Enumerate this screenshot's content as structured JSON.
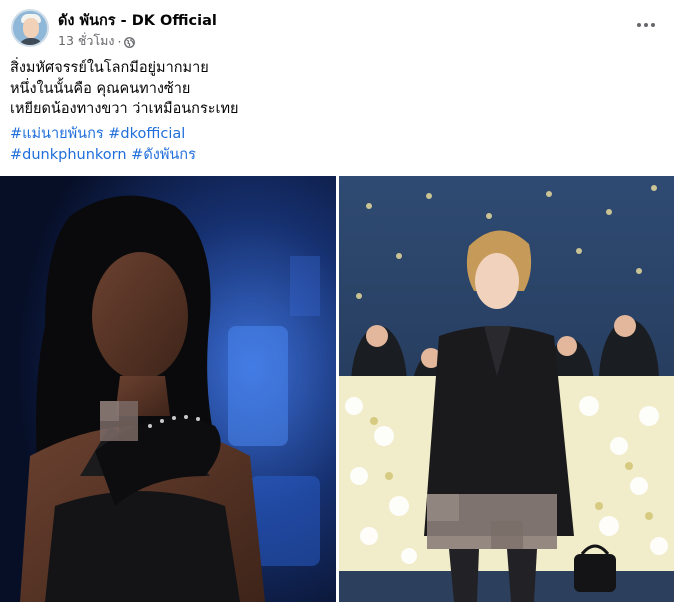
{
  "post": {
    "author": "ดัง พันกร - DK Official",
    "time": "13 ชั่วโมง",
    "separator": "·",
    "privacy_icon": "globe-icon",
    "more_icon": "more-options-icon",
    "text_lines": [
      "สิ่งมหัศจรรย์ในโลกมีอยู่มากมาย",
      "หนึ่งในนั้นคือ คุณคนทางซ้าย",
      "เหยียดน้องทางขวา ว่าเหมือนกระเทย"
    ],
    "hashtags": [
      "#แม่นายพันกร",
      "#dkofficial",
      "#dunkphunkorn",
      "#ดังพันกร"
    ]
  },
  "colors": {
    "link": "#216fdb",
    "secondary_text": "#65676b",
    "primary_text": "#050505"
  }
}
